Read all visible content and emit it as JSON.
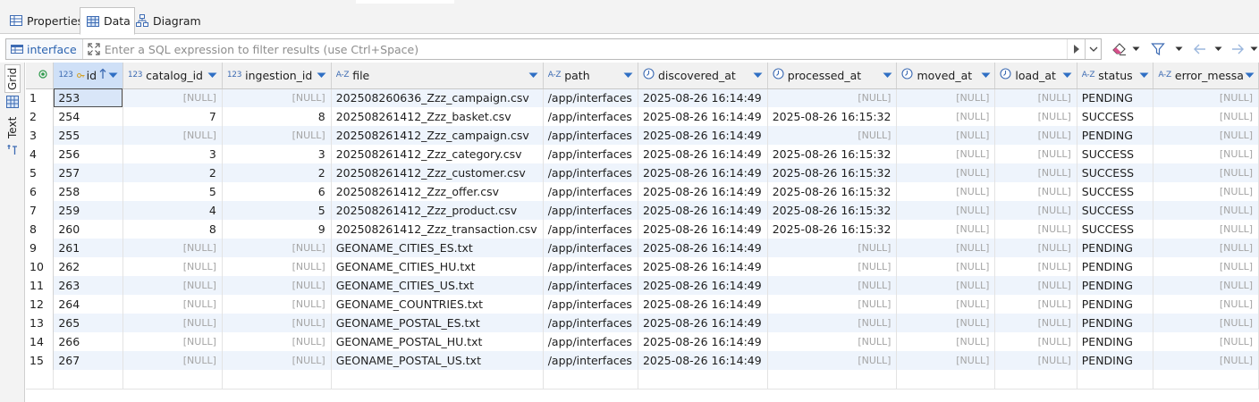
{
  "tabs": [
    {
      "label": "Properties",
      "icon": "properties-icon"
    },
    {
      "label": "Data",
      "icon": "data-grid-icon"
    },
    {
      "label": "Diagram",
      "icon": "diagram-icon"
    }
  ],
  "filter": {
    "table_label": "interface",
    "placeholder": "Enter a SQL expression to filter results (use Ctrl+Space)",
    "value": ""
  },
  "side_panel": {
    "grid_label": "Grid",
    "text_label": "Text"
  },
  "grid": {
    "columns": [
      {
        "name": "id",
        "type": "123",
        "extra": "key"
      },
      {
        "name": "catalog_id",
        "type": "123"
      },
      {
        "name": "ingestion_id",
        "type": "123"
      },
      {
        "name": "file",
        "type": "A-Z"
      },
      {
        "name": "path",
        "type": "A-Z"
      },
      {
        "name": "discovered_at",
        "type": "clock"
      },
      {
        "name": "processed_at",
        "type": "clock"
      },
      {
        "name": "moved_at",
        "type": "clock"
      },
      {
        "name": "load_at",
        "type": "clock"
      },
      {
        "name": "status",
        "type": "A-Z"
      },
      {
        "name": "error_messa",
        "type": "A-Z"
      }
    ],
    "null_text": "[NULL]",
    "rows": [
      {
        "n": "1",
        "id": "253",
        "catalog_id": null,
        "ingestion_id": null,
        "file": "202508260636_Zzz_campaign.csv",
        "path": "/app/interfaces",
        "discovered_at": "2025-08-26 16:14:49",
        "processed_at": null,
        "moved_at": null,
        "load_at": null,
        "status": "PENDING",
        "error_messa": null
      },
      {
        "n": "2",
        "id": "254",
        "catalog_id": "7",
        "ingestion_id": "8",
        "file": "202508261412_Zzz_basket.csv",
        "path": "/app/interfaces",
        "discovered_at": "2025-08-26 16:14:49",
        "processed_at": "2025-08-26 16:15:32",
        "moved_at": null,
        "load_at": null,
        "status": "SUCCESS",
        "error_messa": null
      },
      {
        "n": "3",
        "id": "255",
        "catalog_id": null,
        "ingestion_id": null,
        "file": "202508261412_Zzz_campaign.csv",
        "path": "/app/interfaces",
        "discovered_at": "2025-08-26 16:14:49",
        "processed_at": null,
        "moved_at": null,
        "load_at": null,
        "status": "PENDING",
        "error_messa": null
      },
      {
        "n": "4",
        "id": "256",
        "catalog_id": "3",
        "ingestion_id": "3",
        "file": "202508261412_Zzz_category.csv",
        "path": "/app/interfaces",
        "discovered_at": "2025-08-26 16:14:49",
        "processed_at": "2025-08-26 16:15:32",
        "moved_at": null,
        "load_at": null,
        "status": "SUCCESS",
        "error_messa": null
      },
      {
        "n": "5",
        "id": "257",
        "catalog_id": "2",
        "ingestion_id": "2",
        "file": "202508261412_Zzz_customer.csv",
        "path": "/app/interfaces",
        "discovered_at": "2025-08-26 16:14:49",
        "processed_at": "2025-08-26 16:15:32",
        "moved_at": null,
        "load_at": null,
        "status": "SUCCESS",
        "error_messa": null
      },
      {
        "n": "6",
        "id": "258",
        "catalog_id": "5",
        "ingestion_id": "6",
        "file": "202508261412_Zzz_offer.csv",
        "path": "/app/interfaces",
        "discovered_at": "2025-08-26 16:14:49",
        "processed_at": "2025-08-26 16:15:32",
        "moved_at": null,
        "load_at": null,
        "status": "SUCCESS",
        "error_messa": null
      },
      {
        "n": "7",
        "id": "259",
        "catalog_id": "4",
        "ingestion_id": "5",
        "file": "202508261412_Zzz_product.csv",
        "path": "/app/interfaces",
        "discovered_at": "2025-08-26 16:14:49",
        "processed_at": "2025-08-26 16:15:32",
        "moved_at": null,
        "load_at": null,
        "status": "SUCCESS",
        "error_messa": null
      },
      {
        "n": "8",
        "id": "260",
        "catalog_id": "8",
        "ingestion_id": "9",
        "file": "202508261412_Zzz_transaction.csv",
        "path": "/app/interfaces",
        "discovered_at": "2025-08-26 16:14:49",
        "processed_at": "2025-08-26 16:15:32",
        "moved_at": null,
        "load_at": null,
        "status": "SUCCESS",
        "error_messa": null
      },
      {
        "n": "9",
        "id": "261",
        "catalog_id": null,
        "ingestion_id": null,
        "file": "GEONAME_CITIES_ES.txt",
        "path": "/app/interfaces",
        "discovered_at": "2025-08-26 16:14:49",
        "processed_at": null,
        "moved_at": null,
        "load_at": null,
        "status": "PENDING",
        "error_messa": null
      },
      {
        "n": "10",
        "id": "262",
        "catalog_id": null,
        "ingestion_id": null,
        "file": "GEONAME_CITIES_HU.txt",
        "path": "/app/interfaces",
        "discovered_at": "2025-08-26 16:14:49",
        "processed_at": null,
        "moved_at": null,
        "load_at": null,
        "status": "PENDING",
        "error_messa": null
      },
      {
        "n": "11",
        "id": "263",
        "catalog_id": null,
        "ingestion_id": null,
        "file": "GEONAME_CITIES_US.txt",
        "path": "/app/interfaces",
        "discovered_at": "2025-08-26 16:14:49",
        "processed_at": null,
        "moved_at": null,
        "load_at": null,
        "status": "PENDING",
        "error_messa": null
      },
      {
        "n": "12",
        "id": "264",
        "catalog_id": null,
        "ingestion_id": null,
        "file": "GEONAME_COUNTRIES.txt",
        "path": "/app/interfaces",
        "discovered_at": "2025-08-26 16:14:49",
        "processed_at": null,
        "moved_at": null,
        "load_at": null,
        "status": "PENDING",
        "error_messa": null
      },
      {
        "n": "13",
        "id": "265",
        "catalog_id": null,
        "ingestion_id": null,
        "file": "GEONAME_POSTAL_ES.txt",
        "path": "/app/interfaces",
        "discovered_at": "2025-08-26 16:14:49",
        "processed_at": null,
        "moved_at": null,
        "load_at": null,
        "status": "PENDING",
        "error_messa": null
      },
      {
        "n": "14",
        "id": "266",
        "catalog_id": null,
        "ingestion_id": null,
        "file": "GEONAME_POSTAL_HU.txt",
        "path": "/app/interfaces",
        "discovered_at": "2025-08-26 16:14:49",
        "processed_at": null,
        "moved_at": null,
        "load_at": null,
        "status": "PENDING",
        "error_messa": null
      },
      {
        "n": "15",
        "id": "267",
        "catalog_id": null,
        "ingestion_id": null,
        "file": "GEONAME_POSTAL_US.txt",
        "path": "/app/interfaces",
        "discovered_at": "2025-08-26 16:14:49",
        "processed_at": null,
        "moved_at": null,
        "load_at": null,
        "status": "PENDING",
        "error_messa": null
      }
    ]
  },
  "colors": {
    "accent": "#2b63b0",
    "row_stripe": "#eef4fc",
    "null_text": "#a5a5a5",
    "header_bg": "#f1f1f1"
  }
}
